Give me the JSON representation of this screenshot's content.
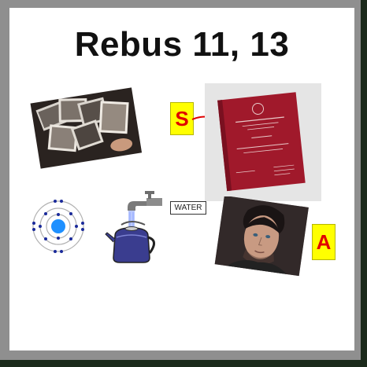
{
  "slide": {
    "title": "Rebus 11, 13"
  },
  "clues": {
    "letter_s": "S",
    "letter_a": "A",
    "water_label": "WATER",
    "thesis_cover_lines": [
      "Università degli Studi di Roma \"Tor Vergata\"",
      "Facoltà di Lettere e Filosofia",
      "TESI DI LAUREA"
    ]
  },
  "colors": {
    "letter_box": "#ffff00",
    "letter_text": "#e00000",
    "thesis_cover": "#a0192b",
    "atom_nucleus": "#1e90ff",
    "kettle_body": "#3a3d8f",
    "water_stream": "#b9c8ff"
  },
  "icons": [
    "photos-image",
    "thesis-book-image",
    "atom-icon",
    "kettle-tap-icon",
    "portrait-image"
  ]
}
